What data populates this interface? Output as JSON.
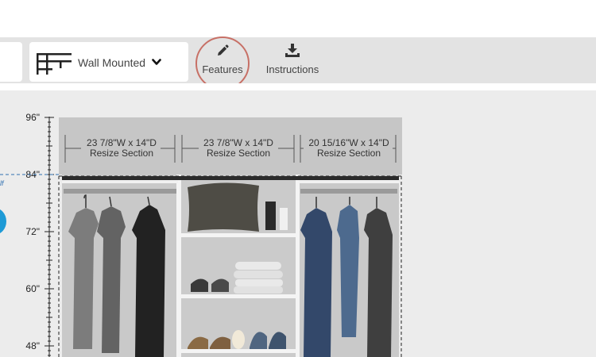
{
  "toolbar": {
    "closet_style": {
      "label": "Wall Mounted",
      "icon": "wall-mounted-shelf-icon"
    },
    "features": {
      "label": "Features",
      "icon": "pencil-icon"
    },
    "instructions": {
      "label": "Instructions",
      "icon": "download-icon"
    }
  },
  "ruler": {
    "marks": [
      "96\"",
      "84\"",
      "72\"",
      "60\"",
      "48\""
    ]
  },
  "side_panel": {
    "text": "lf"
  },
  "sections": [
    {
      "dimension": "23 7/8\"W x 14\"D",
      "action": "Resize Section"
    },
    {
      "dimension": "23 7/8\"W x 14\"D",
      "action": "Resize Section"
    },
    {
      "dimension": "20 15/16\"W x 14\"D",
      "action": "Resize Section"
    }
  ],
  "colors": {
    "highlight_ring": "#c77066",
    "toolbar_bg": "#e3e3e3",
    "accent_blue": "#1e9ad6",
    "dashed_line": "#2f6fb0"
  }
}
